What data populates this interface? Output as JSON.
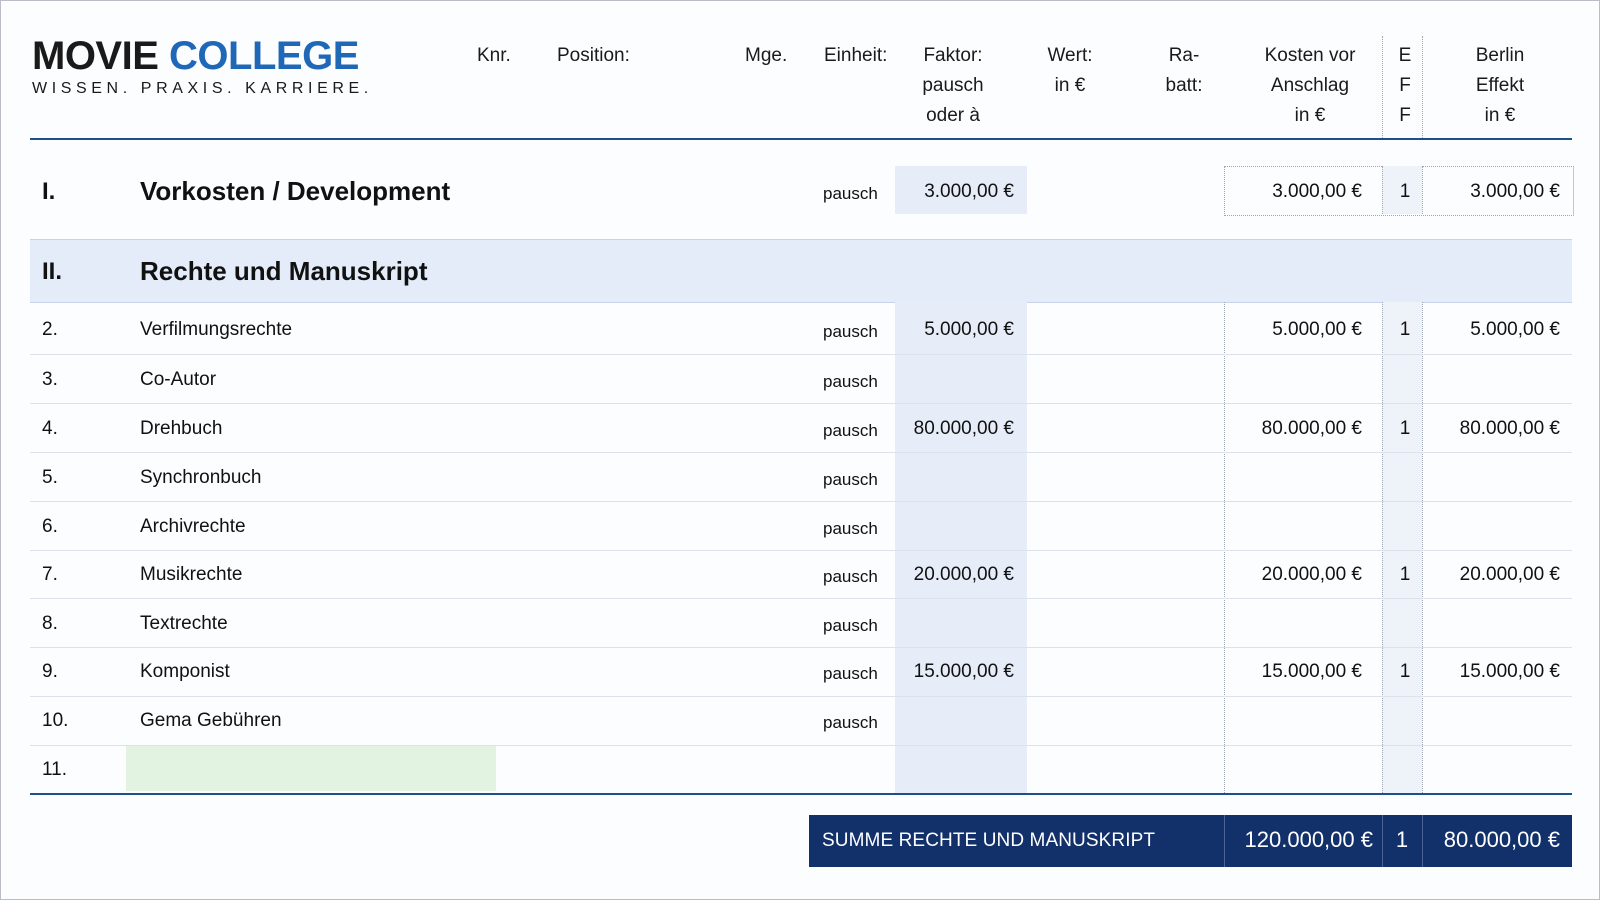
{
  "logo": {
    "part1": "MOVIE",
    "part2": "COLLEGE",
    "tagline": "WISSEN. PRAXIS. KARRIERE."
  },
  "header": {
    "knr": "Knr.",
    "position": "Position:",
    "mge": "Mge.",
    "einheit": "Einheit:",
    "faktor": [
      "Faktor:",
      "pausch",
      "oder à"
    ],
    "wert": [
      "Wert:",
      "in €"
    ],
    "rabatt": [
      "Ra-",
      "batt:"
    ],
    "kosten": [
      "Kosten vor",
      "Anschlag",
      "in €"
    ],
    "eff": [
      "E",
      "F",
      "F"
    ],
    "berlin": [
      "Berlin",
      "Effekt",
      "in €"
    ]
  },
  "section1": {
    "num": "I.",
    "title": "Vorkosten / Development",
    "unit": "pausch",
    "faktor": "3.000,00 €",
    "kosten": "3.000,00 €",
    "eff": "1",
    "berlin": "3.000,00 €"
  },
  "section2": {
    "num": "II.",
    "title": "Rechte und Manuskript"
  },
  "rows": [
    {
      "num": "2.",
      "pos": "Verfilmungsrechte",
      "unit": "pausch",
      "faktor": "5.000,00 €",
      "kosten": "5.000,00 €",
      "eff": "1",
      "berlin": "5.000,00 €"
    },
    {
      "num": "3.",
      "pos": "Co-Autor",
      "unit": "pausch",
      "faktor": "",
      "kosten": "",
      "eff": "",
      "berlin": ""
    },
    {
      "num": "4.",
      "pos": "Drehbuch",
      "unit": "pausch",
      "faktor": "80.000,00 €",
      "kosten": "80.000,00 €",
      "eff": "1",
      "berlin": "80.000,00 €"
    },
    {
      "num": "5.",
      "pos": "Synchronbuch",
      "unit": "pausch",
      "faktor": "",
      "kosten": "",
      "eff": "",
      "berlin": ""
    },
    {
      "num": "6.",
      "pos": "Archivrechte",
      "unit": "pausch",
      "faktor": "",
      "kosten": "",
      "eff": "",
      "berlin": ""
    },
    {
      "num": "7.",
      "pos": "Musikrechte",
      "unit": "pausch",
      "faktor": "20.000,00 €",
      "kosten": "20.000,00 €",
      "eff": "1",
      "berlin": "20.000,00 €"
    },
    {
      "num": "8.",
      "pos": "Textrechte",
      "unit": "pausch",
      "faktor": "",
      "kosten": "",
      "eff": "",
      "berlin": ""
    },
    {
      "num": "9.",
      "pos": "Komponist",
      "unit": "pausch",
      "faktor": "15.000,00 €",
      "kosten": "15.000,00 €",
      "eff": "1",
      "berlin": "15.000,00 €"
    },
    {
      "num": "10.",
      "pos": "Gema Gebühren",
      "unit": "pausch",
      "faktor": "",
      "kosten": "",
      "eff": "",
      "berlin": ""
    },
    {
      "num": "11.",
      "pos": "",
      "unit": "",
      "faktor": "",
      "kosten": "",
      "eff": "",
      "berlin": ""
    }
  ],
  "summary": {
    "label": "SUMME RECHTE UND MANUSKRIPT",
    "kosten": "120.000,00 €",
    "eff": "1",
    "berlin": "80.000,00 €"
  }
}
